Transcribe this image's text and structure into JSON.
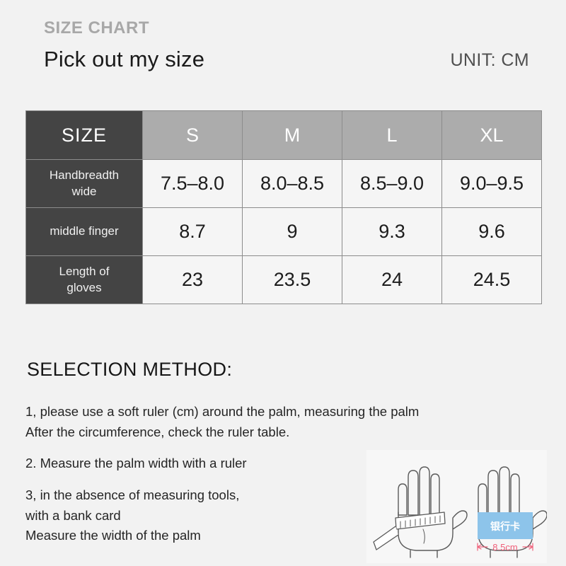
{
  "header": {
    "eyebrow": "SIZE CHART",
    "title": "Pick out my size",
    "unit": "UNIT: CM"
  },
  "table": {
    "columns": [
      "SIZE",
      "S",
      "M",
      "L",
      "XL"
    ],
    "rows": [
      {
        "label": "Handbreadth wide",
        "label_line1": "Handbreadth",
        "label_line2": "wide",
        "values": [
          "7.5–8.0",
          "8.0–8.5",
          "8.5–9.0",
          "9.0–9.5"
        ]
      },
      {
        "label": "middle finger",
        "label_line1": "middle finger",
        "label_line2": "",
        "values": [
          "8.7",
          "9",
          "9.3",
          "9.6"
        ]
      },
      {
        "label": "Length of gloves",
        "label_line1": "Length of",
        "label_line2": "gloves",
        "values": [
          "23",
          "23.5",
          "24",
          "24.5"
        ]
      }
    ]
  },
  "method": {
    "heading": "SELECTION METHOD:",
    "steps": [
      "1, please use a soft ruler (cm) around the palm, measuring the palm<br>After the circumference, check the ruler table.",
      "2. Measure the palm width with a ruler",
      "3, in the absence of measuring tools,<br>with a bank card<br>Measure the width of the palm"
    ]
  },
  "illustration": {
    "card_label": "银行卡",
    "dimension_label": "8.5cm",
    "card_color": "#8dc4ea",
    "dimension_color": "#f0607a"
  },
  "colors": {
    "page_background": "#f2f2f2",
    "header_dark": "#444444",
    "header_gray": "#acacac",
    "cell_background": "#f5f5f5",
    "eyebrow_text": "#a8a8a8"
  }
}
